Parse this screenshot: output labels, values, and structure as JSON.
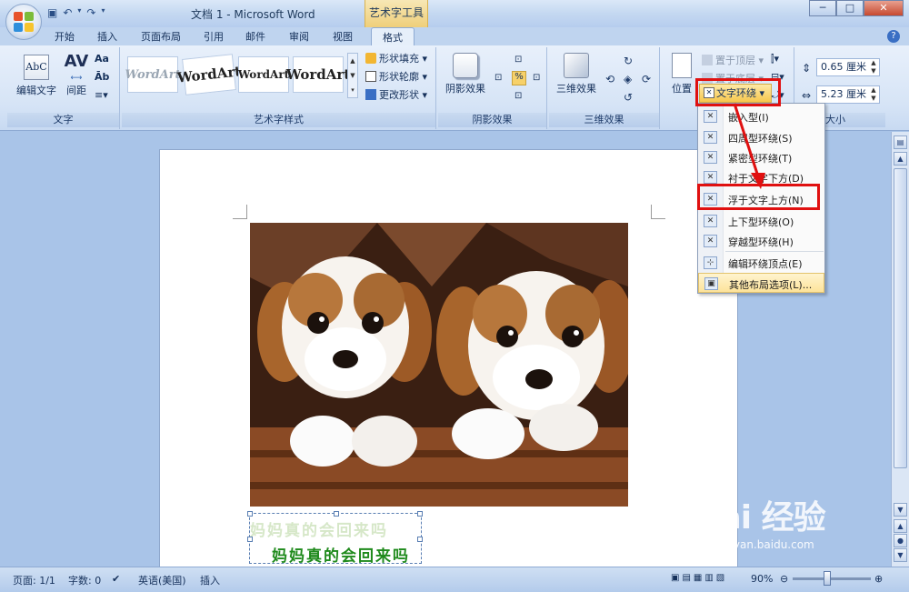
{
  "window": {
    "title": "文档 1 - Microsoft Word",
    "context_tab_title": "艺术字工具",
    "controls": [
      "─",
      "□",
      "✕"
    ]
  },
  "tabs": [
    {
      "label": "开始"
    },
    {
      "label": "插入"
    },
    {
      "label": "页面布局"
    },
    {
      "label": "引用"
    },
    {
      "label": "邮件"
    },
    {
      "label": "审阅"
    },
    {
      "label": "视图"
    },
    {
      "label": "格式",
      "active": true
    }
  ],
  "ribbon": {
    "text_group": {
      "label": "文字",
      "edit_text": "编辑文字",
      "spacing": "间距"
    },
    "wordart_styles_group": {
      "label": "艺术字样式",
      "samples": [
        "WordArt",
        "WordArt",
        "WordArt",
        "WordArt"
      ],
      "shape_fill": "形状填充",
      "shape_outline": "形状轮廓",
      "change_shape": "更改形状"
    },
    "shadow_group": {
      "label": "阴影效果",
      "shadow_effects": "阴影效果"
    },
    "threed_group": {
      "label": "三维效果",
      "threed_effects": "三维效果"
    },
    "arrange_group": {
      "position": "位置",
      "bring_to_front": "置于顶层",
      "send_to_back": "置于底层",
      "text_wrap": "文字环绕"
    },
    "size_group": {
      "label": "大小",
      "height": "0.65 厘米",
      "width": "5.23 厘米"
    }
  },
  "wrap_menu": {
    "items": [
      {
        "label": "嵌入型(I)"
      },
      {
        "label": "四周型环绕(S)"
      },
      {
        "label": "紧密型环绕(T)"
      },
      {
        "label": "衬于文字下方(D)"
      },
      {
        "label": "浮于文字上方(N)"
      },
      {
        "label": "上下型环绕(O)"
      },
      {
        "label": "穿越型环绕(H)"
      },
      {
        "label": "编辑环绕顶点(E)"
      },
      {
        "label": "其他布局选项(L)...",
        "highlighted": true
      }
    ]
  },
  "document": {
    "wordart_line1": "妈妈真的会回来吗",
    "wordart_line2": "妈妈真的会回来吗"
  },
  "statusbar": {
    "page": "页面: 1/1",
    "words": "字数: 0",
    "language": "英语(美国)",
    "mode": "插入",
    "zoom": "90%"
  },
  "watermark": {
    "logo": "Bai 经验",
    "url": "jingyan.baidu.com"
  },
  "colors": {
    "accent": "#e01010",
    "ribbon": "#dbe7f6",
    "context_tab": "#f1d27f"
  }
}
